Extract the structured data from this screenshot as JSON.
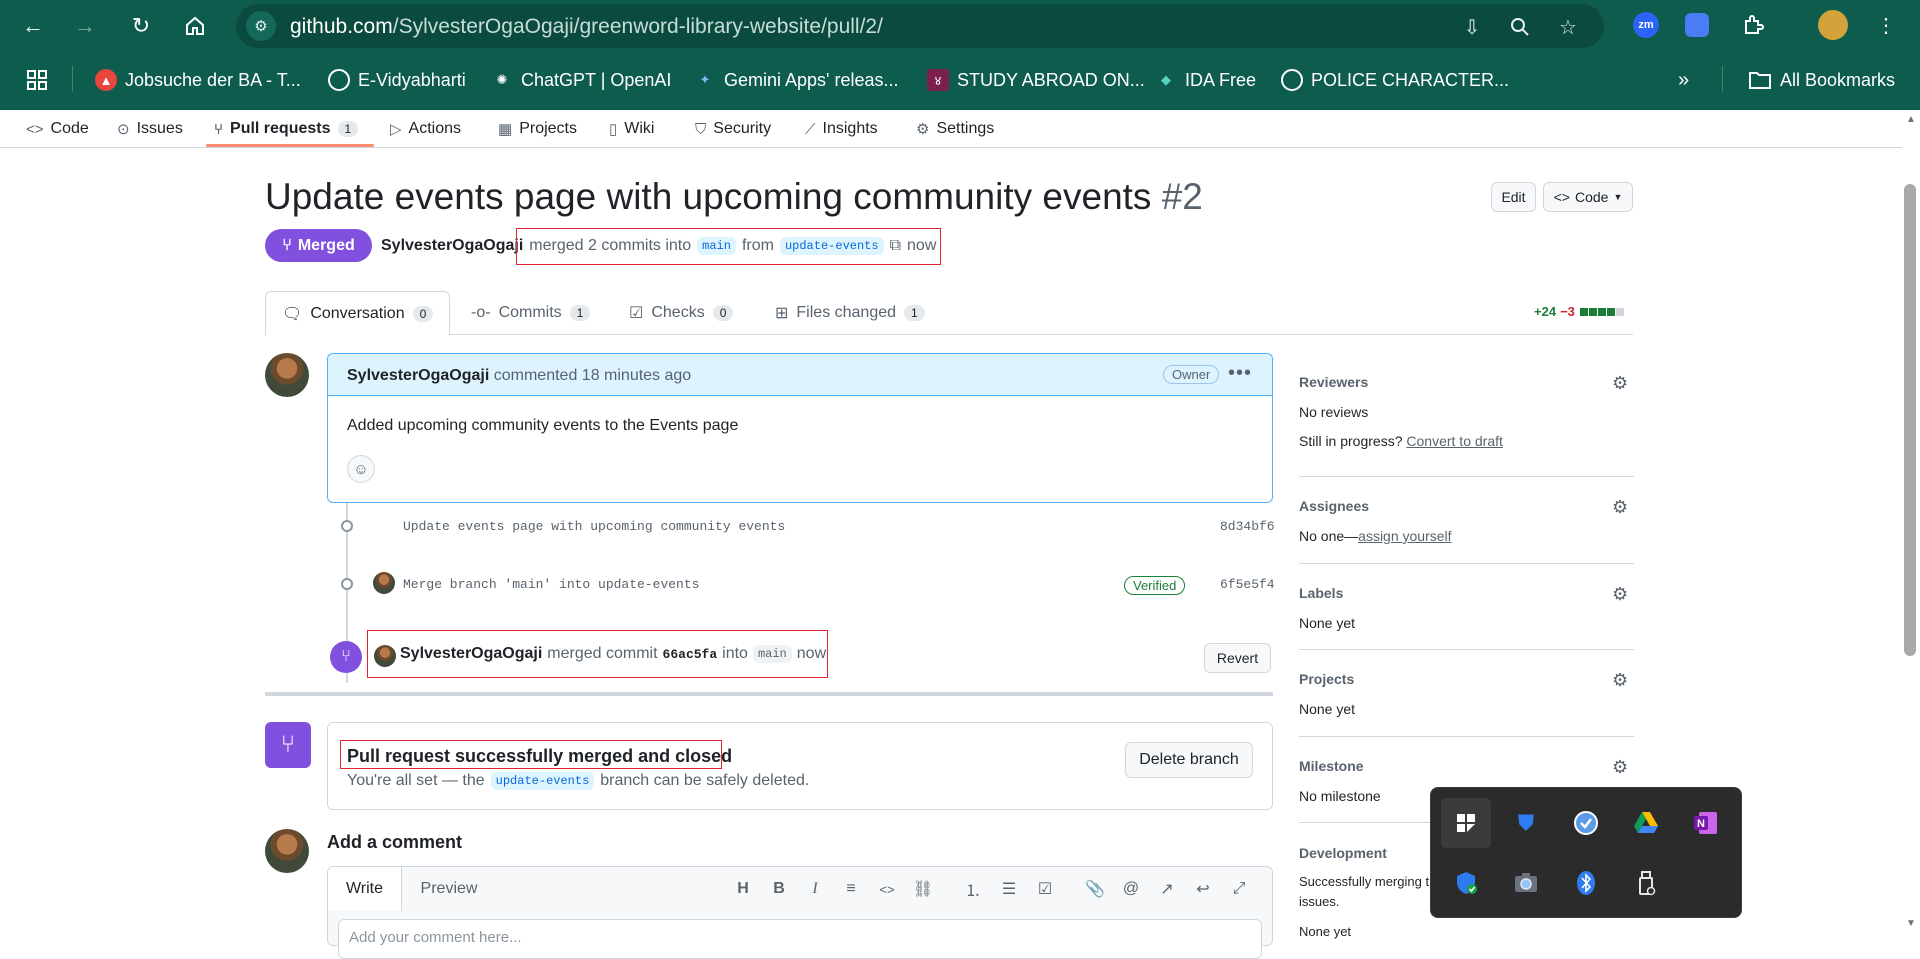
{
  "browser": {
    "url_host": "github.com",
    "url_path": "/SylvesterOgaOgaji/greenword-library-website/pull/2/",
    "bookmarks": [
      {
        "label": "Jobsuche der BA - T...",
        "color": "#e8453c",
        "glyph": "▲"
      },
      {
        "label": "E-Vidyabharti",
        "color": "#0e5c4d",
        "glyph": "◍"
      },
      {
        "label": "ChatGPT | OpenAI",
        "color": "#0e5c4d",
        "glyph": "✺"
      },
      {
        "label": "Gemini Apps' releas...",
        "color": "#0e5c4d",
        "glyph": "✦"
      },
      {
        "label": "STUDY ABROAD ON...",
        "color": "#7b1f4f",
        "glyph": "४"
      },
      {
        "label": "IDA Free",
        "color": "#0e5c4d",
        "glyph": "◆"
      },
      {
        "label": "POLICE CHARACTER...",
        "color": "#0e5c4d",
        "glyph": "◍"
      }
    ],
    "all_bookmarks": "All Bookmarks",
    "ext_zm": "zm"
  },
  "repo_nav": {
    "code": "Code",
    "issues": "Issues",
    "pull_requests": "Pull requests",
    "pull_requests_count": "1",
    "actions": "Actions",
    "projects": "Projects",
    "wiki": "Wiki",
    "security": "Security",
    "insights": "Insights",
    "settings": "Settings"
  },
  "pr": {
    "title": "Update events page with upcoming community events",
    "number": "#2",
    "edit_label": "Edit",
    "code_label": "Code",
    "state": "Merged",
    "author": "SylvesterOgaOgaji",
    "merged_text": "merged 2 commits into",
    "base_branch": "main",
    "from_text": "from",
    "head_branch": "update-events",
    "time": "now"
  },
  "tabs": {
    "conversation": "Conversation",
    "conversation_count": "0",
    "commits": "Commits",
    "commits_count": "1",
    "checks": "Checks",
    "checks_count": "0",
    "files_changed": "Files changed",
    "files_changed_count": "1",
    "additions": "+24",
    "deletions": "−3",
    "diff_blocks": [
      "#1a7f37",
      "#1a7f37",
      "#1a7f37",
      "#1a7f37",
      "#d0d7de"
    ]
  },
  "comment": {
    "author": "SylvesterOgaOgaji",
    "action": "commented 18 minutes ago",
    "badge": "Owner",
    "body": "Added upcoming community events to the Events page"
  },
  "commits": [
    {
      "message": "Update events page with upcoming community events",
      "sha": "8d34bf6"
    },
    {
      "message": "Merge branch 'main' into update-events",
      "sha": "6f5e5f4",
      "verified": "Verified"
    }
  ],
  "merge_event": {
    "author": "SylvesterOgaOgaji",
    "text": "merged commit",
    "commit": "66ac5fa",
    "into": "into",
    "branch": "main",
    "time": "now",
    "revert_label": "Revert"
  },
  "mergebox": {
    "title": "Pull request successfully merged and closed",
    "sub_prefix": "You're all set — the",
    "branch": "update-events",
    "sub_suffix": "branch can be safely deleted.",
    "delete_label": "Delete branch"
  },
  "new_comment": {
    "heading": "Add a comment",
    "write_tab": "Write",
    "preview_tab": "Preview",
    "placeholder": "Add your comment here..."
  },
  "sidebar": {
    "reviewers": {
      "heading": "Reviewers",
      "value": "No reviews",
      "draft_prefix": "Still in progress?",
      "draft_link": "Convert to draft"
    },
    "assignees": {
      "heading": "Assignees",
      "prefix": "No one—",
      "link": "assign yourself"
    },
    "labels": {
      "heading": "Labels",
      "value": "None yet"
    },
    "projects": {
      "heading": "Projects",
      "value": "None yet"
    },
    "milestone": {
      "heading": "Milestone",
      "value": "No milestone"
    },
    "development": {
      "heading": "Development",
      "value_line1": "Successfully merging t",
      "value_line2": "issues.",
      "value_line3": "None yet"
    }
  },
  "tray": {
    "icons": [
      "snip-icon",
      "defender-icon",
      "network-tool-icon",
      "google-drive-icon",
      "onenote-icon",
      "security-check-icon",
      "camera-app-icon",
      "bluetooth-icon",
      "usb-drive-icon"
    ]
  }
}
